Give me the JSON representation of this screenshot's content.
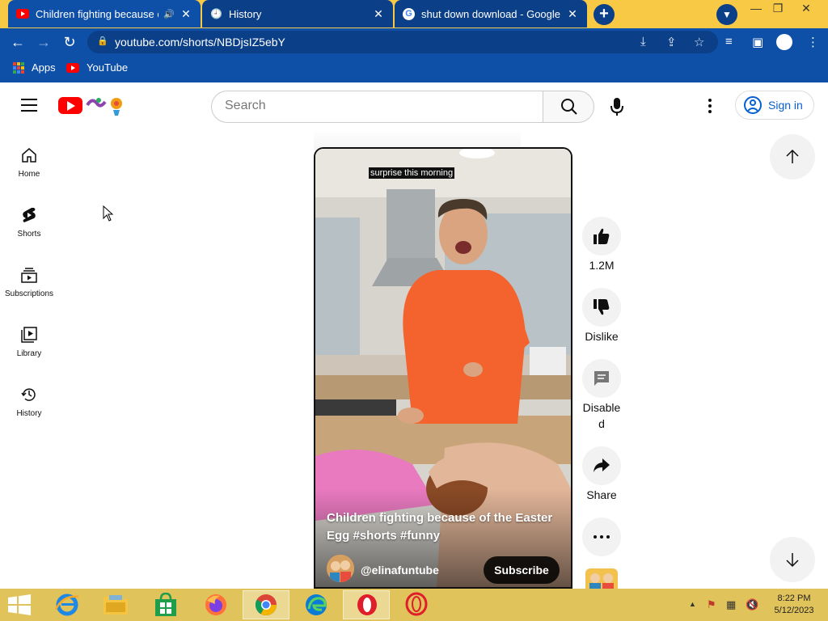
{
  "browser": {
    "tabs": [
      {
        "title": "Children fighting because of",
        "active": true,
        "audio": true
      },
      {
        "title": "History",
        "active": false
      },
      {
        "title": "shut down download - Google S",
        "active": false
      }
    ],
    "new_tab_symbol": "+",
    "address": "youtube.com/shorts/NBDjsIZ5ebY",
    "bookmarks": [
      {
        "label": "Apps"
      },
      {
        "label": "YouTube"
      }
    ]
  },
  "youtube": {
    "search_placeholder": "Search",
    "sign_in_label": "Sign in",
    "nav": [
      {
        "label": "Home"
      },
      {
        "label": "Shorts"
      },
      {
        "label": "Subscriptions"
      },
      {
        "label": "Library"
      },
      {
        "label": "History"
      }
    ],
    "short": {
      "caption": "surprise this morning",
      "title": "Children fighting because of the Easter Egg #shorts #funny",
      "channel": "@elinafuntube",
      "subscribe_label": "Subscribe"
    },
    "actions": {
      "likes": "1.2M",
      "dislike_label": "Dislike",
      "comments_label_line1": "Disable",
      "comments_label_line2": "d",
      "share_label": "Share"
    }
  },
  "taskbar": {
    "time": "8:22 PM",
    "date": "5/12/2023"
  },
  "colors": {
    "tab_strip": "#f7c944",
    "browser_chrome": "#0e4fa8",
    "youtube_red": "#ff0000",
    "link_blue": "#065fd4",
    "taskbar": "#e0c35a"
  }
}
